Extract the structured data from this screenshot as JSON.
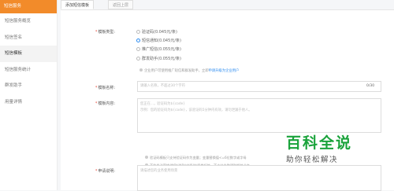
{
  "sidebar": {
    "header": "短信服务",
    "items": [
      {
        "label": "短信服务概览",
        "active": false
      },
      {
        "label": "短信签名",
        "active": false
      },
      {
        "label": "短信模板",
        "active": true
      },
      {
        "label": "短信服务统计",
        "active": false
      },
      {
        "label": "群发助手",
        "active": false
      },
      {
        "label": "用量详情",
        "active": false
      }
    ]
  },
  "tabs": [
    {
      "label": "添加短信模板",
      "active": true
    },
    {
      "label": "返回上层",
      "active": false
    }
  ],
  "form": {
    "type_label": "模板类型:",
    "types": [
      {
        "label": "验证码(0.045元/条)",
        "selected": false
      },
      {
        "label": "短信通知(0.045元/条)",
        "selected": true
      },
      {
        "label": "推广短信(0.055元/条)",
        "selected": false
      },
      {
        "label": "群发助手(0.055元/条)",
        "selected": false
      }
    ],
    "enterprise_note": "企业用户可使用推广短信和群发助手，立即",
    "enterprise_link": "申请升级为企业用户",
    "name_label": "模板名称:",
    "name_placeholder": "请输入名称，不超过30个字符",
    "name_counter": "0/30",
    "content_label": "模板内容:",
    "content_placeholder_1": "您正在...，验证码为${code}",
    "content_placeholder_2": "示例：您的验证码为${code}，该验证码5分钟内有效，请勿泄漏于他人。",
    "hints": [
      "验证码模板只支持验证码作为变量；变量替换值<=6位数字或字母",
      "不能发送营销/贷款/借款/中奖/抽奖类短信，不支持金融理财相关业务",
      "签名+模板内容超过70字按67字/条计费，"
    ],
    "hint_link": "https://help.aliyun.com/document_detail/55324.h",
    "reason_label": "申请说明:",
    "reason_placeholder": "请描述您的业务使用场景"
  },
  "watermark": {
    "title": "百科全说",
    "subtitle": "助你轻松解决"
  },
  "colors": {
    "sidebar_header": "#f28b2a",
    "link": "#2d8cf0",
    "required": "#e74c3c",
    "watermark": "#1aa33b"
  }
}
